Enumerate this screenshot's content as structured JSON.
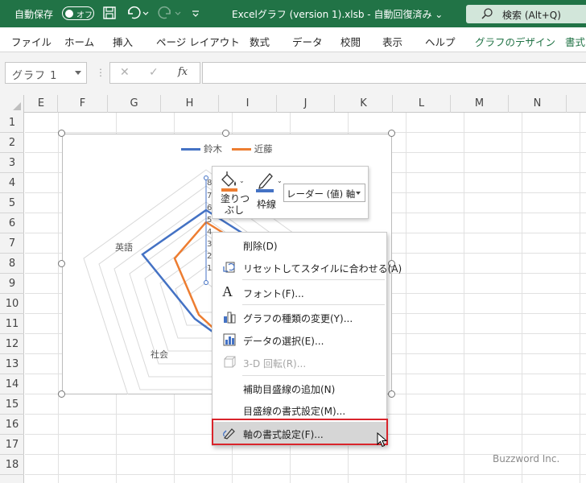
{
  "titlebar": {
    "autosave_label": "自動保存",
    "autosave_state": "オフ",
    "filename": "Excelグラフ (version 1).xlsb  -  自動回復済み ⌄",
    "search_placeholder": "検索 (Alt+Q)"
  },
  "ribbon": {
    "tabs": [
      "ファイル",
      "ホーム",
      "挿入",
      "ページ レイアウト",
      "数式",
      "データ",
      "校閲",
      "表示",
      "ヘルプ",
      "グラフのデザイン",
      "書式"
    ]
  },
  "formula_bar": {
    "name_box": "グラフ 1",
    "separator": "⋮",
    "cancel": "✕",
    "enter": "✓",
    "fx": "fx",
    "value": ""
  },
  "grid": {
    "columns": [
      "E",
      "F",
      "G",
      "H",
      "I",
      "J",
      "K",
      "L",
      "M",
      "N"
    ],
    "rows": [
      "1",
      "2",
      "3",
      "4",
      "5",
      "6",
      "7",
      "8",
      "9",
      "10",
      "11",
      "12",
      "13",
      "14",
      "15",
      "16",
      "17",
      "18"
    ]
  },
  "chart": {
    "legend": [
      {
        "name": "鈴木",
        "color": "#4472c4"
      },
      {
        "name": "近藤",
        "color": "#ed7d31"
      }
    ],
    "category_labels": {
      "english": "英語",
      "social": "社会"
    },
    "axis_ticks": [
      "8",
      "7",
      "6",
      "5",
      "4",
      "3",
      "2",
      "1"
    ]
  },
  "mini_toolbar": {
    "fill_label_1": "塗りつ",
    "fill_label_2": "ぶし",
    "outline_label": "枠線",
    "element_select": "レーダー (値) 軸"
  },
  "context_menu": {
    "items": [
      {
        "label": "削除(D)",
        "icon": "delete-icon",
        "enabled": true
      },
      {
        "label": "リセットしてスタイルに合わせる(A)",
        "icon": "reset-style-icon",
        "enabled": true
      },
      {
        "label": "フォント(F)...",
        "icon": "font-icon",
        "enabled": true
      },
      {
        "label": "グラフの種類の変更(Y)...",
        "icon": "chart-type-icon",
        "enabled": true
      },
      {
        "label": "データの選択(E)...",
        "icon": "select-data-icon",
        "enabled": true
      },
      {
        "label": "3-D 回転(R)...",
        "icon": "3d-rotation-icon",
        "enabled": false
      },
      {
        "label": "補助目盛線の追加(N)",
        "icon": "",
        "enabled": true
      },
      {
        "label": "目盛線の書式設定(M)...",
        "icon": "",
        "enabled": true
      },
      {
        "label": "軸の書式設定(F)...",
        "icon": "format-axis-icon",
        "enabled": true,
        "highlighted": true
      }
    ]
  },
  "watermark": "Buzzword Inc.",
  "colors": {
    "excel_green": "#217346",
    "series_suzuki": "#4472c4",
    "series_kondo": "#ed7d31",
    "highlight_box": "#d9242b"
  }
}
